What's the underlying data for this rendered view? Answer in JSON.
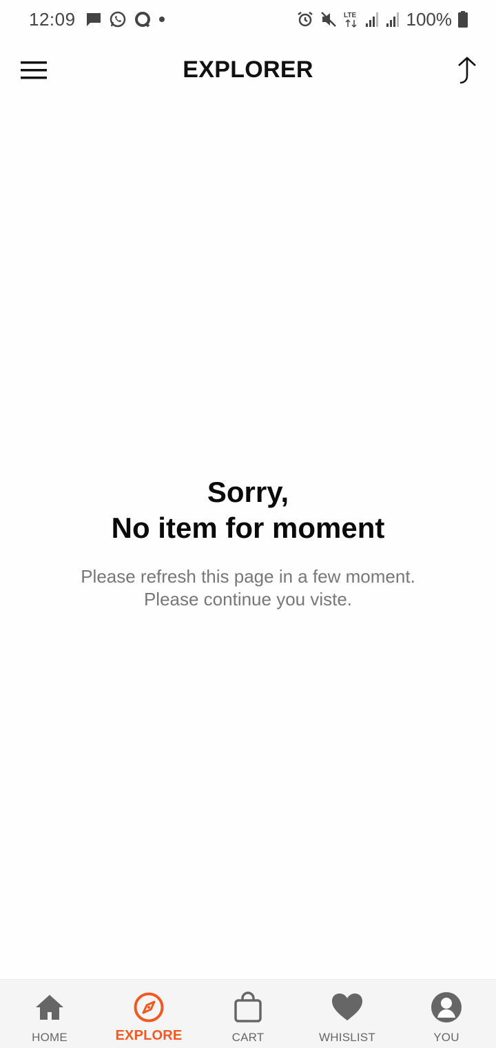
{
  "status_bar": {
    "time": "12:09",
    "battery_text": "100%",
    "network_label": "LTE"
  },
  "app_bar": {
    "title": "EXPLORER"
  },
  "empty_state": {
    "line1": "Sorry,",
    "line2": "No item for moment",
    "message_line1": "Please refresh this page in a few moment.",
    "message_line2": "Please continue you viste."
  },
  "bottom_nav": {
    "items": [
      {
        "label": "HOME",
        "icon": "home-icon"
      },
      {
        "label": "EXPLORE",
        "icon": "compass-icon",
        "active": true
      },
      {
        "label": "CART",
        "icon": "shopping-bag-icon"
      },
      {
        "label": "WHISLIST",
        "icon": "heart-icon"
      },
      {
        "label": "YOU",
        "icon": "user-icon"
      }
    ]
  },
  "colors": {
    "accent": "#f05a22",
    "nav_icon": "#666666",
    "title": "#111111",
    "message": "#777777"
  }
}
